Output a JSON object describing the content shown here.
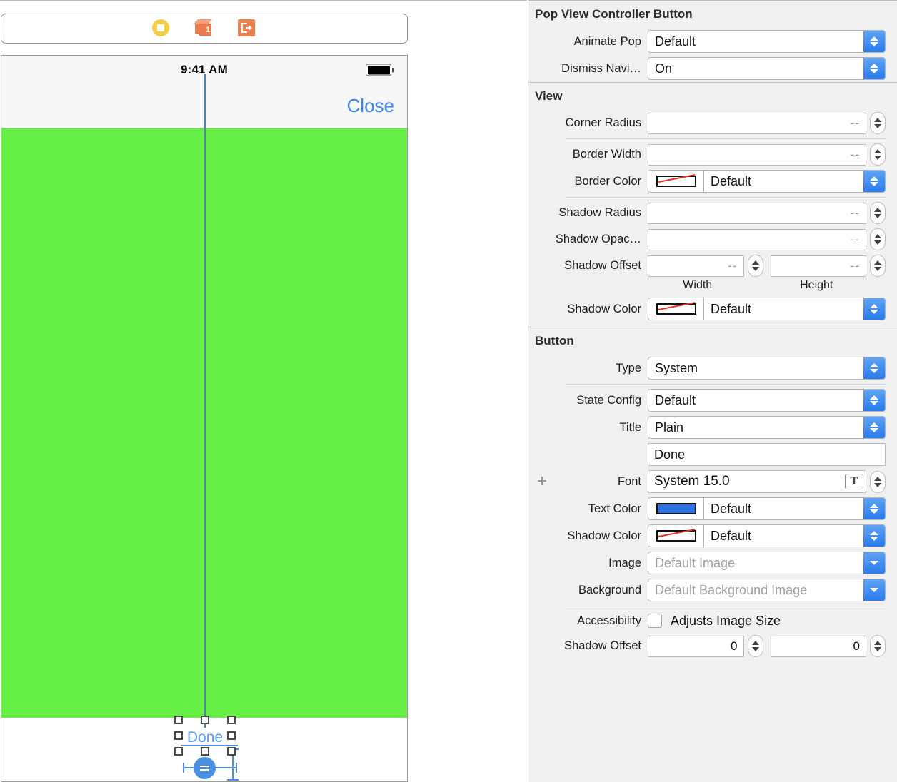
{
  "canvas": {
    "dock": {
      "view_controller_icon": "view-controller-icon",
      "first_responder_icon": "first-responder-icon",
      "first_responder_badge": "1",
      "exit_icon": "exit-icon"
    },
    "device": {
      "status_time": "9:41 AM",
      "battery_icon": "battery-icon",
      "nav_close_label": "Close",
      "content_color": "#66f046",
      "guide_color": "#5383ad",
      "selected_button_title": "Done",
      "selected_button_color": "#5b9cf8",
      "constraint_badge_icon": "equal-constraint-icon"
    }
  },
  "inspector": {
    "sections": [
      {
        "title": "Pop View Controller Button",
        "rows": [
          {
            "label": "Animate Pop",
            "kind": "popup",
            "value": "Default"
          },
          {
            "label": "Dismiss Navi…",
            "kind": "popup",
            "value": "On"
          }
        ]
      },
      {
        "title": "View",
        "rows": [
          {
            "label": "Corner Radius",
            "kind": "stepper-field",
            "value": "--"
          },
          {
            "label": "Border Width",
            "kind": "stepper-field",
            "value": "--"
          },
          {
            "label": "Border Color",
            "kind": "color-popup",
            "value": "Default",
            "swatch": "none"
          },
          {
            "label": "Shadow Radius",
            "kind": "stepper-field",
            "value": "--"
          },
          {
            "label": "Shadow Opac…",
            "kind": "stepper-field",
            "value": "--"
          },
          {
            "label": "Shadow Offset",
            "kind": "dual-stepper",
            "value_width": "--",
            "value_height": "--",
            "sub_width": "Width",
            "sub_height": "Height"
          },
          {
            "label": "Shadow Color",
            "kind": "color-popup",
            "value": "Default",
            "swatch": "none"
          }
        ]
      },
      {
        "title": "Button",
        "rows": [
          {
            "label": "Type",
            "kind": "popup",
            "value": "System"
          },
          {
            "label": "State Config",
            "kind": "popup",
            "value": "Default"
          },
          {
            "label": "Title",
            "kind": "popup",
            "value": "Plain"
          },
          {
            "label": "",
            "kind": "text",
            "value": "Done"
          },
          {
            "label": "Font",
            "kind": "font",
            "value": "System 15.0",
            "plus": "+",
            "font_icon_glyph": "T"
          },
          {
            "label": "Text Color",
            "kind": "color-popup",
            "value": "Default",
            "swatch": "blue"
          },
          {
            "label": "Shadow Color",
            "kind": "color-popup",
            "value": "Default",
            "swatch": "none"
          },
          {
            "label": "Image",
            "kind": "popup-single",
            "placeholder": "Default Image"
          },
          {
            "label": "Background",
            "kind": "popup-single",
            "placeholder": "Default Background Image"
          },
          {
            "label": "Accessibility",
            "kind": "checkbox",
            "value": "Adjusts Image Size",
            "checked": false
          },
          {
            "label": "Shadow Offset",
            "kind": "dual-stepper",
            "value_width": "0",
            "value_height": "0"
          }
        ]
      }
    ]
  }
}
